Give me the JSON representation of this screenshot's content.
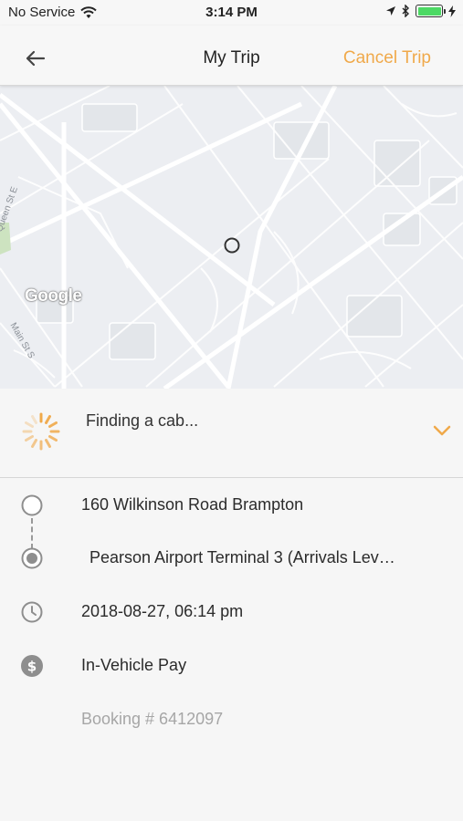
{
  "status_bar": {
    "carrier": "No Service",
    "time": "3:14 PM"
  },
  "nav": {
    "title": "My Trip",
    "cancel_label": "Cancel Trip"
  },
  "map": {
    "labels": {
      "queen_st": "Queen St E",
      "main_st": "Main St S"
    },
    "attribution": "Google"
  },
  "status_panel": {
    "message": "Finding a cab..."
  },
  "trip": {
    "pickup": "160 Wilkinson Road Brampton",
    "dropoff": "Pearson Airport Terminal 3 (Arrivals Lev…",
    "datetime": "2018-08-27, 06:14 pm",
    "payment": "In-Vehicle Pay",
    "booking": "Booking # 6412097"
  },
  "colors": {
    "accent": "#f0a94a",
    "icon_gray": "#8e8e8e"
  }
}
